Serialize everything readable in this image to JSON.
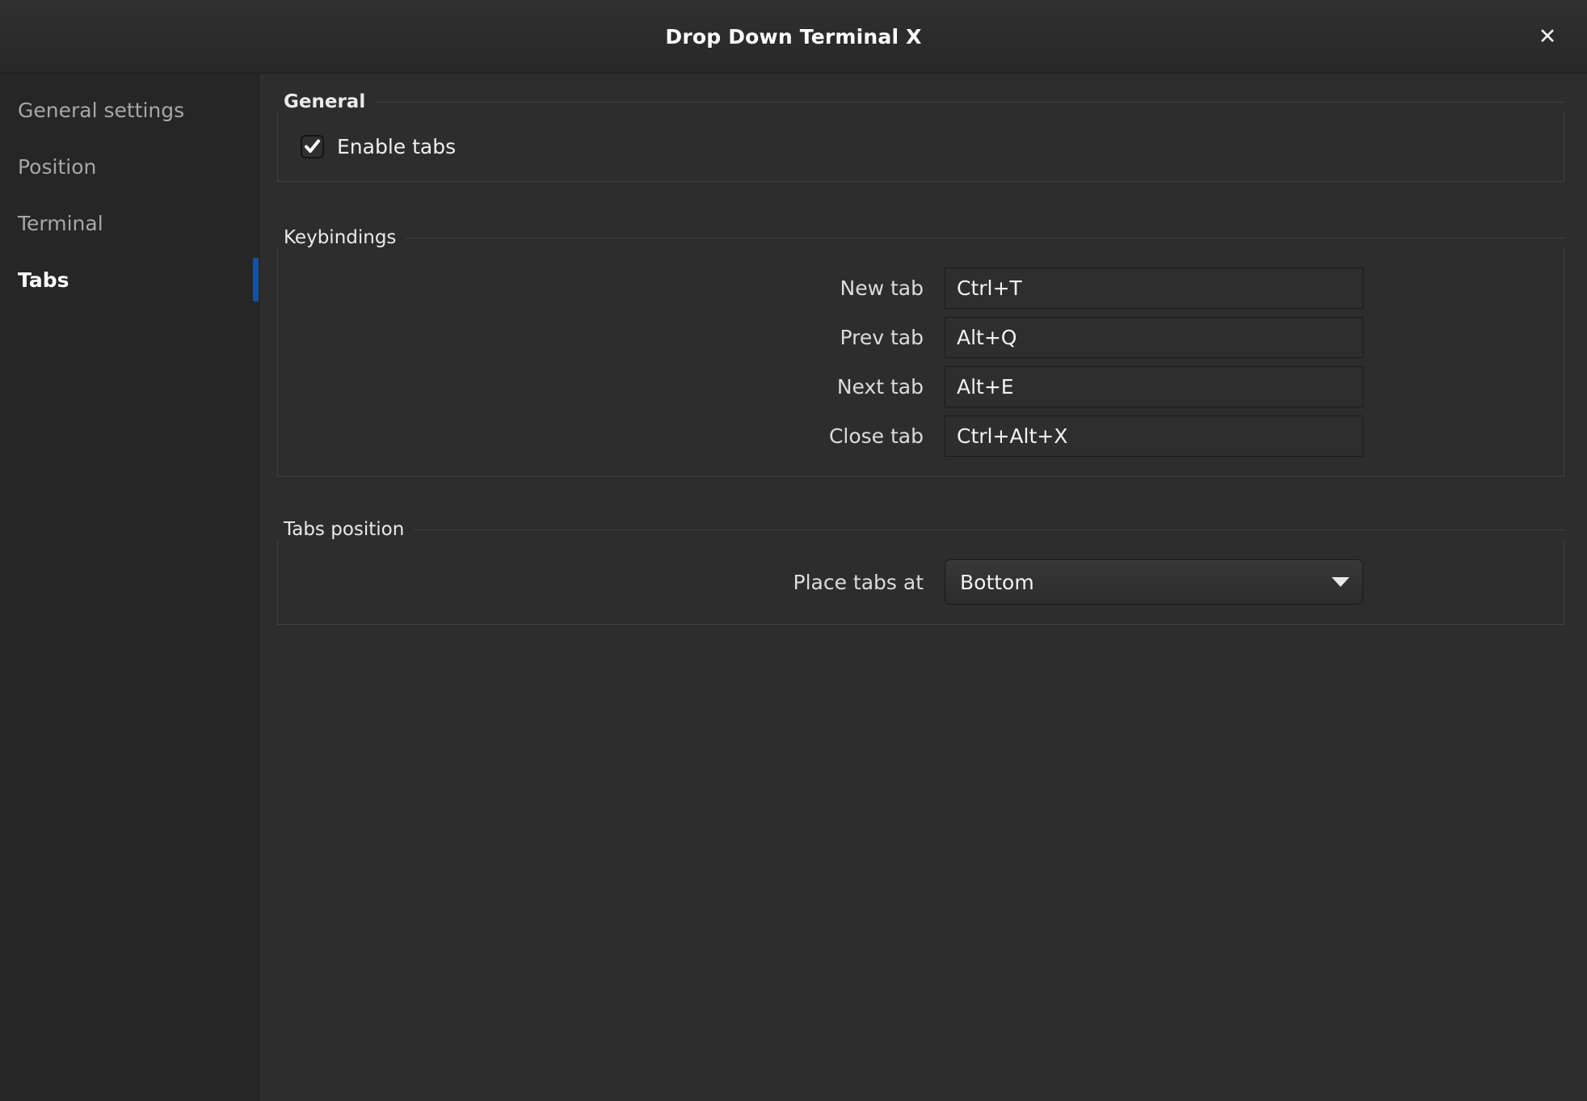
{
  "window": {
    "title": "Drop Down Terminal X",
    "close_icon": "close-icon",
    "accent_color": "#15539e",
    "background": "#2d2d2d",
    "sidebar_background": "#262626"
  },
  "sidebar": {
    "items": [
      {
        "label": "General settings",
        "selected": false
      },
      {
        "label": "Position",
        "selected": false
      },
      {
        "label": "Terminal",
        "selected": false
      },
      {
        "label": "Tabs",
        "selected": true
      }
    ]
  },
  "general": {
    "title": "General",
    "enable_tabs": {
      "label": "Enable tabs",
      "checked": true,
      "icon": "checkmark-icon"
    }
  },
  "keybindings": {
    "title": "Keybindings",
    "rows": [
      {
        "label": "New tab",
        "value": "Ctrl+T"
      },
      {
        "label": "Prev tab",
        "value": "Alt+Q"
      },
      {
        "label": "Next tab",
        "value": "Alt+E"
      },
      {
        "label": "Close tab",
        "value": "Ctrl+Alt+X"
      }
    ]
  },
  "tabs_position": {
    "title": "Tabs position",
    "place_tabs_at": {
      "label": "Place tabs at",
      "value": "Bottom",
      "arrow_icon": "chevron-down-icon"
    }
  }
}
